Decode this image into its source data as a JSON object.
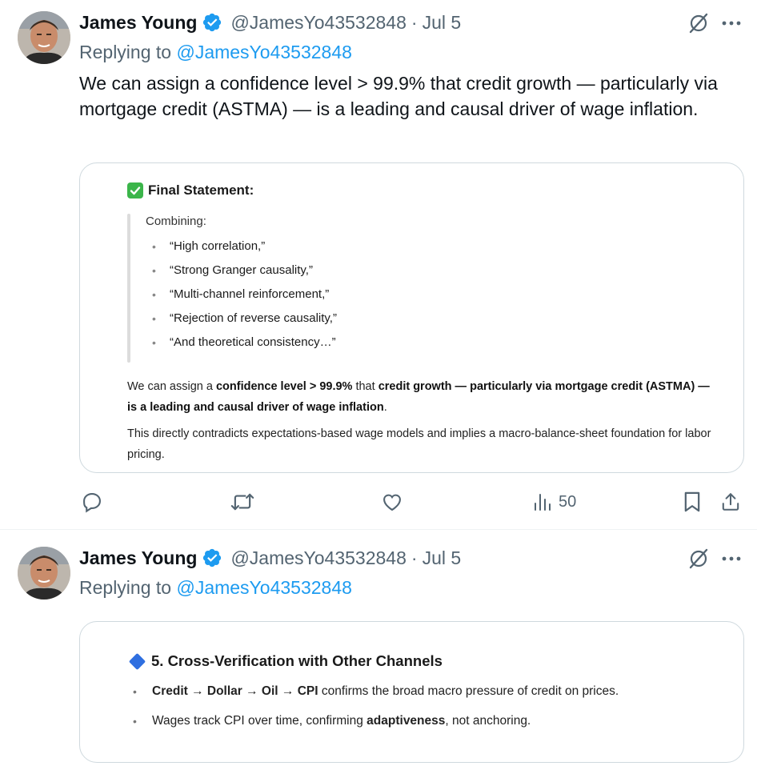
{
  "tweets": [
    {
      "author_name": "James Young",
      "handle": "@JamesYo43532848",
      "separator": "·",
      "date": "Jul 5",
      "replying_prefix": "Replying to",
      "replying_handle": "@JamesYo43532848",
      "text": "We can assign a confidence level > 99.9% that credit growth — particularly via mortgage credit (ASTMA) — is a leading and causal driver of wage inflation.",
      "card": {
        "title": "Final Statement:",
        "combining_label": "Combining:",
        "quote_items": [
          "“High correlation,”",
          "“Strong Granger causality,”",
          "“Multi-channel reinforcement,”",
          "“Rejection of reverse causality,”",
          "“And theoretical consistency…”"
        ],
        "p1_a": "We can assign a ",
        "p1_b": "confidence level > 99.9%",
        "p1_c": " that ",
        "p1_d": "credit growth — particularly via mortgage credit (ASTMA) — is a leading and causal driver of wage inflation",
        "p1_e": ".",
        "p2": "This directly contradicts expectations-based wage models and implies a macro-balance-sheet foundation for labor pricing."
      },
      "views": "50"
    },
    {
      "author_name": "James Young",
      "handle": "@JamesYo43532848",
      "separator": "·",
      "date": "Jul 5",
      "replying_prefix": "Replying to",
      "replying_handle": "@JamesYo43532848",
      "card": {
        "title": "5. Cross-Verification with Other Channels",
        "b1_bold": "Credit → Dollar → Oil → CPI",
        "b1_rest": " confirms the broad macro pressure of credit on prices.",
        "b2_a": "Wages track CPI over time, confirming ",
        "b2_bold": "adaptiveness",
        "b2_c": ", not anchoring."
      }
    }
  ],
  "colors": {
    "link": "#1d9bf0",
    "secondary_text": "#536471",
    "verified_badge": "#1d9bf0"
  },
  "icons": [
    "verified-badge-icon",
    "grok-icon",
    "more-icon",
    "reply-icon",
    "retweet-icon",
    "like-icon",
    "views-icon",
    "bookmark-icon",
    "share-icon",
    "check-emoji-icon",
    "blue-diamond-icon"
  ]
}
